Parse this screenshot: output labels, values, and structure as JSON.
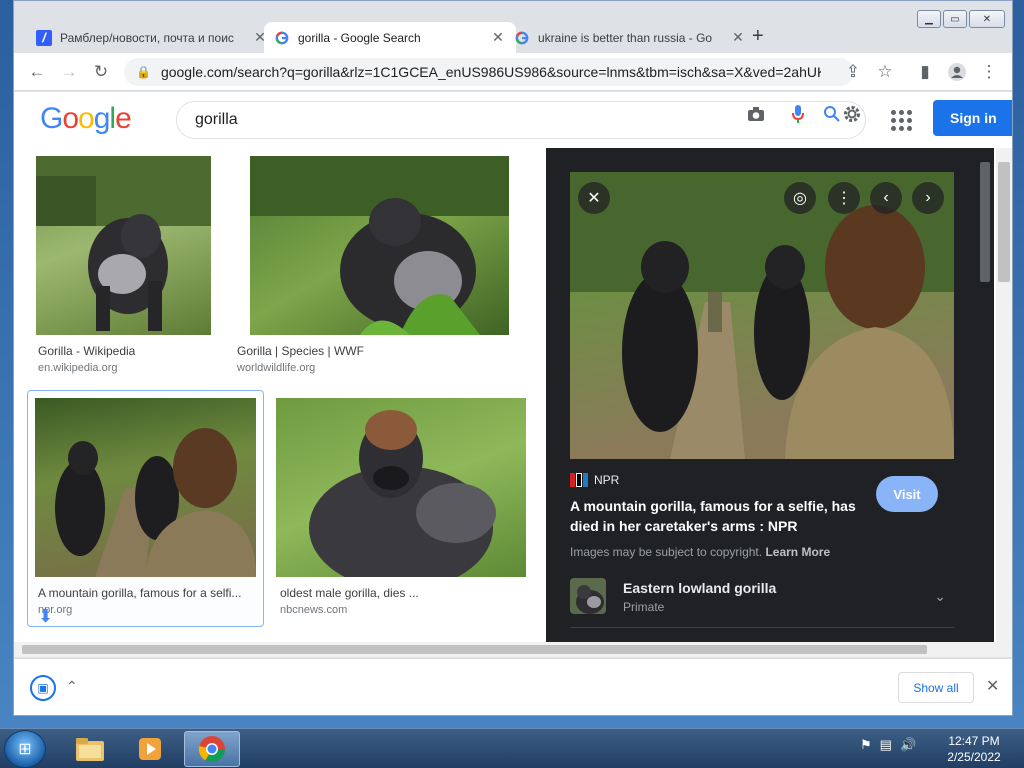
{
  "browser": {
    "tabs": [
      {
        "title": "Рамблер/новости, почта и поис",
        "favicon": "rambler-icon",
        "active": false
      },
      {
        "title": "gorilla - Google Search",
        "favicon": "google-icon",
        "active": true
      },
      {
        "title": "ukraine is better than russia - Go",
        "favicon": "google-icon",
        "active": false
      }
    ],
    "new_tab": "+",
    "url": "google.com/search?q=gorilla&rlz=1C1GCEA_enUS986US986&source=lnms&tbm=isch&sa=X&ved=2ahUK..."
  },
  "google": {
    "logo": [
      "G",
      "o",
      "o",
      "g",
      "l",
      "e"
    ],
    "query": "gorilla",
    "sign_in": "Sign in"
  },
  "results": [
    {
      "caption": "Gorilla - Wikipedia",
      "source": "en.wikipedia.org"
    },
    {
      "caption": "Gorilla | Species | WWF",
      "source": "worldwildlife.org"
    },
    {
      "caption": "A mountain gorilla, famous for a selfi...",
      "source": "npr.org"
    },
    {
      "caption": "oldest male gorilla, dies ...",
      "source": "nbcnews.com"
    }
  ],
  "preview": {
    "source": "NPR",
    "title": "A mountain gorilla, famous for a selfie, has died in her caretaker's arms : NPR",
    "visit": "Visit",
    "copyright": "Images may be subject to copyright.",
    "learn_more": "Learn More",
    "related": {
      "title": "Eastern lowland gorilla",
      "subtitle": "Primate"
    }
  },
  "downloads": {
    "show_all": "Show all"
  },
  "taskbar": {
    "time": "12:47 PM",
    "date": "2/25/2022"
  },
  "colors": {
    "accent": "#1a73e8",
    "panel_bg": "#202124",
    "visit": "#8ab4f8"
  }
}
